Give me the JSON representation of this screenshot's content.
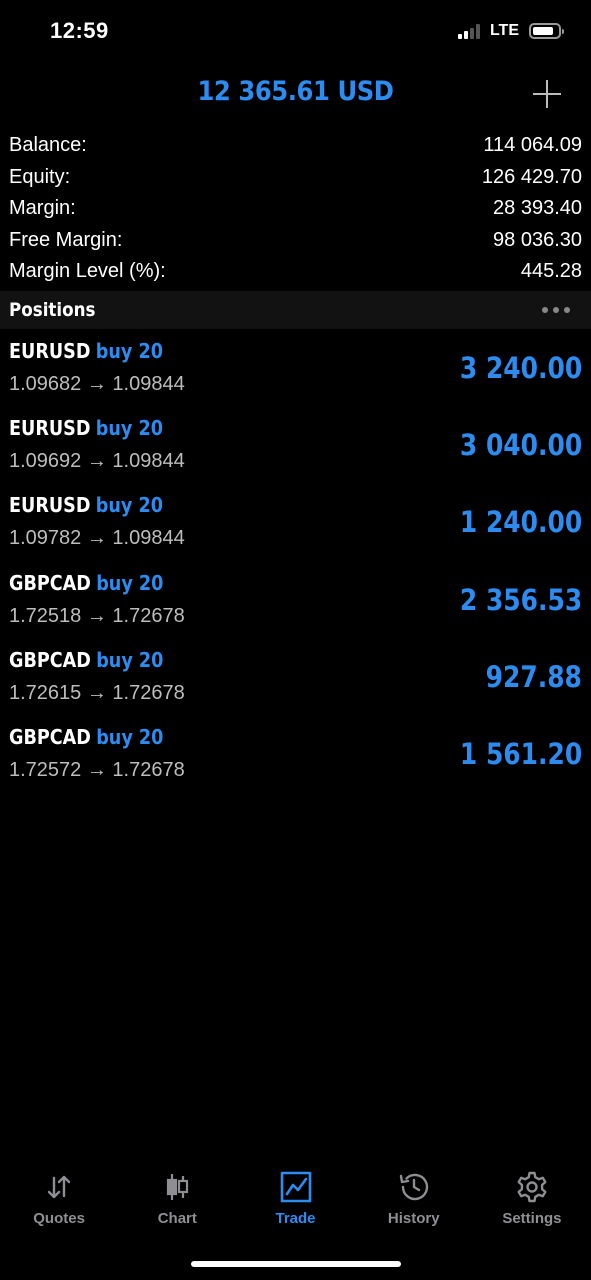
{
  "status_bar": {
    "time": "12:59",
    "network": "LTE"
  },
  "header": {
    "title": "12 365.61 USD"
  },
  "summary": [
    {
      "label": "Balance:",
      "value": "114 064.09"
    },
    {
      "label": "Equity:",
      "value": "126 429.70"
    },
    {
      "label": "Margin:",
      "value": "28 393.40"
    },
    {
      "label": "Free Margin:",
      "value": "98 036.30"
    },
    {
      "label": "Margin Level (%):",
      "value": "445.28"
    }
  ],
  "positions_section": {
    "title": "Positions"
  },
  "positions": [
    {
      "symbol": "EURUSD",
      "action": "buy 20",
      "prices": "1.09682 → 1.09844",
      "profit": "3 240.00"
    },
    {
      "symbol": "EURUSD",
      "action": "buy 20",
      "prices": "1.09692 → 1.09844",
      "profit": "3 040.00"
    },
    {
      "symbol": "EURUSD",
      "action": "buy 20",
      "prices": "1.09782 → 1.09844",
      "profit": "1 240.00"
    },
    {
      "symbol": "GBPCAD",
      "action": "buy 20",
      "prices": "1.72518 → 1.72678",
      "profit": "2 356.53"
    },
    {
      "symbol": "GBPCAD",
      "action": "buy 20",
      "prices": "1.72615 → 1.72678",
      "profit": "927.88"
    },
    {
      "symbol": "GBPCAD",
      "action": "buy 20",
      "prices": "1.72572 → 1.72678",
      "profit": "1 561.20"
    }
  ],
  "tabs": [
    {
      "label": "Quotes",
      "icon": "quotes-arrows-icon",
      "active": false
    },
    {
      "label": "Chart",
      "icon": "candlestick-icon",
      "active": false
    },
    {
      "label": "Trade",
      "icon": "trade-chart-icon",
      "active": true
    },
    {
      "label": "History",
      "icon": "history-clock-icon",
      "active": false
    },
    {
      "label": "Settings",
      "icon": "gear-icon",
      "active": false
    }
  ],
  "colors": {
    "accent": "#2d8cf0",
    "background": "#000000",
    "muted": "#8e8e93",
    "secondary_text": "#bdbdbd"
  }
}
